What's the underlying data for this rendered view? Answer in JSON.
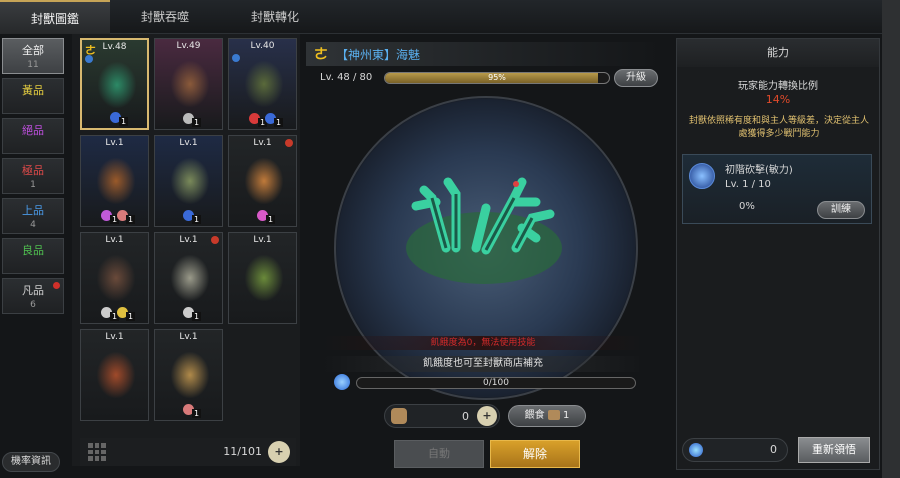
{
  "tabs": [
    {
      "label": "封獸圖鑑",
      "active": true
    },
    {
      "label": "封獸吞噬"
    },
    {
      "label": "封獸轉化"
    }
  ],
  "categories": [
    {
      "label": "全部",
      "count": "11",
      "color": "#f0f0f0",
      "active": true
    },
    {
      "label": "黃品",
      "count": "",
      "color": "#e8d040"
    },
    {
      "label": "絕品",
      "count": "",
      "color": "#c050e0"
    },
    {
      "label": "極品",
      "count": "1",
      "color": "#e04a4a"
    },
    {
      "label": "上品",
      "count": "4",
      "color": "#4a9ae8"
    },
    {
      "label": "良品",
      "count": "",
      "color": "#50c050"
    },
    {
      "label": "凡品",
      "count": "6",
      "color": "#d0d0d0",
      "alert": true
    }
  ],
  "probability_label": "機率資訊",
  "grid": [
    {
      "lv": "Lv.48",
      "selected": true,
      "tag": "ㄜ",
      "blue": true,
      "bg": "#2a3a30",
      "beast": "#2c8a66",
      "gems": [
        {
          "c": "#3a6ad8",
          "n": "1"
        }
      ]
    },
    {
      "lv": "Lv.49",
      "bg": "#4a2a40",
      "beast": "#8a5a3a",
      "gems": [
        {
          "c": "#bbbbbb",
          "n": "1"
        }
      ]
    },
    {
      "lv": "Lv.40",
      "blue": true,
      "bg": "#28304a",
      "beast": "#5a6a3a",
      "gems": [
        {
          "c": "#d83a3a",
          "n": "1"
        },
        {
          "c": "#3a6ad8",
          "n": "1"
        }
      ]
    },
    {
      "lv": "Lv.1",
      "bg": "#1e2a44",
      "beast": "#9a5a2a",
      "gems": [
        {
          "c": "#c05ad8",
          "n": "1"
        },
        {
          "c": "#d87a7a",
          "n": "1"
        }
      ]
    },
    {
      "lv": "Lv.1",
      "bg": "#1e2a44",
      "beast": "#7a8a5a",
      "gems": [
        {
          "c": "#3a6ad8",
          "n": "1"
        }
      ]
    },
    {
      "lv": "Lv.1",
      "alert": true,
      "bg": "#222527",
      "beast": "#c07a3a",
      "gems": [
        {
          "c": "#d85ac8",
          "n": "1"
        }
      ]
    },
    {
      "lv": "Lv.1",
      "bg": "#222527",
      "beast": "#6a4a3a",
      "gems": [
        {
          "c": "#cccccc",
          "n": "1"
        },
        {
          "c": "#e0c040",
          "n": "1"
        }
      ]
    },
    {
      "lv": "Lv.1",
      "alert": true,
      "bg": "#222527",
      "beast": "#9a9a8a",
      "gems": [
        {
          "c": "#cccccc",
          "n": "1"
        }
      ]
    },
    {
      "lv": "Lv.1",
      "bg": "#222527",
      "beast": "#6a8a3a",
      "gems": []
    },
    {
      "lv": "Lv.1",
      "bg": "#222527",
      "beast": "#a04a2a",
      "gems": []
    },
    {
      "lv": "Lv.1",
      "bg": "#222527",
      "beast": "#b08a4a",
      "gems": [
        {
          "c": "#d87a7a",
          "n": "1"
        }
      ]
    }
  ],
  "grid_count": "11/101",
  "beast": {
    "tag": "ㄜ",
    "name": "【神州東】海魅",
    "lv_text": "Lv. 48 / 80",
    "progress": "95%",
    "progress_frac": 0.95,
    "upgrade": "升級"
  },
  "warn_text": "飢餓度為0，無法使用技能",
  "hint_text": "飢餓度也可至封獸商店補充",
  "satiety": "0/100",
  "food_count": "0",
  "feed_label": "餵食",
  "feed_count": "1",
  "btn_left": "自動",
  "btn_release": "解除",
  "right": {
    "title": "能力",
    "ratio_label": "玩家能力轉換比例",
    "ratio": "14%",
    "desc": "封獸依照稀有度和與主人等級差，決定從主人處獲得多少戰鬥能力",
    "skill_name": "初階砍擊(敏力)",
    "skill_lv": "Lv. 1 / 10",
    "skill_pct": "0%",
    "train": "訓練",
    "orb_count": "0",
    "relearn": "重新領悟"
  },
  "colors": {
    "accent": "#d8b970",
    "warn": "#d02a2a",
    "ratio": "#e04a2a"
  }
}
